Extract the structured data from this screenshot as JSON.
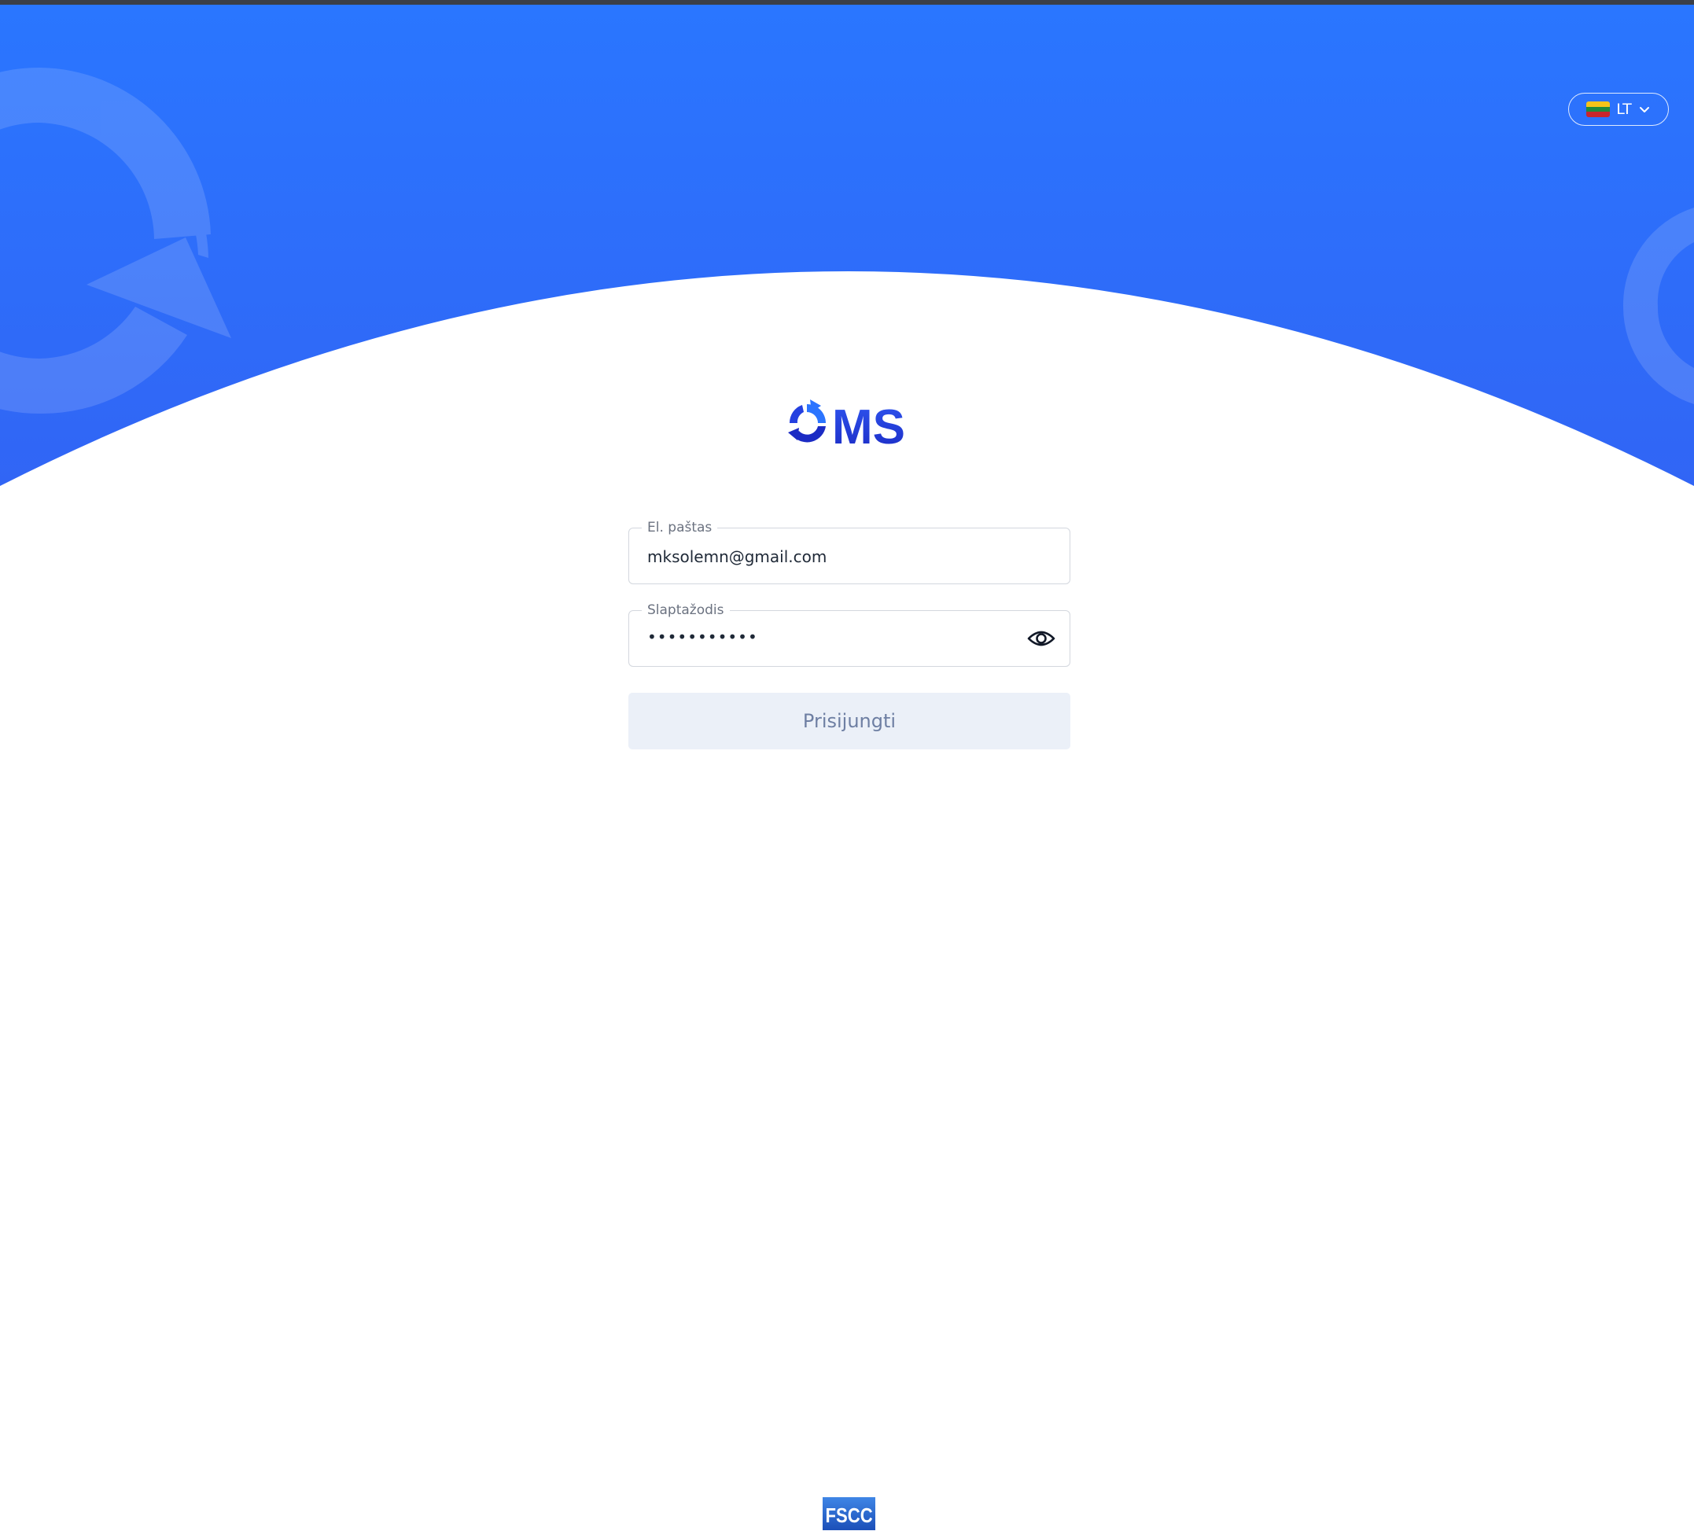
{
  "brand": {
    "logo_text": "MS",
    "primary_color": "#2b74ff",
    "logo_color": "#1d3bd6",
    "footer_logo_text": "FSCC"
  },
  "language": {
    "code": "LT",
    "flag_icon": "lithuania-flag-icon"
  },
  "form": {
    "email": {
      "label": "El. paštas",
      "value": "mksolemn@gmail.com"
    },
    "password": {
      "label": "Slaptažodis",
      "value": "•••••••••••",
      "toggle_icon": "eye-icon"
    },
    "submit_label": "Prisijungti"
  }
}
